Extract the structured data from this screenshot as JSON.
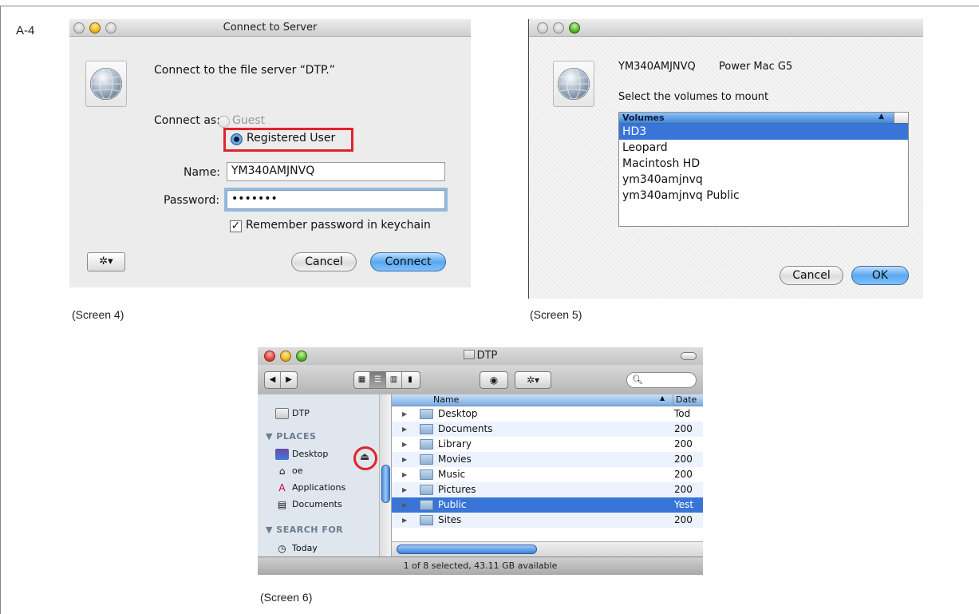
{
  "page_label": "A-4",
  "captions": {
    "screen4": "(Screen 4)",
    "screen5": "(Screen 5)",
    "screen6": "(Screen 6)"
  },
  "screen4": {
    "title": "Connect to Server",
    "message": "Connect to the file server “DTP.”",
    "connect_as_label": "Connect as:",
    "guest_label": "Guest",
    "registered_label": "Registered User",
    "name_label": "Name:",
    "name_value": "YM340AMJNVQ",
    "password_label": "Password:",
    "password_value": "•••••••",
    "remember_label": "Remember password in keychain",
    "cancel_label": "Cancel",
    "connect_label": "Connect",
    "gear_icon": "gear-icon"
  },
  "screen5": {
    "server_id": "YM340AMJNVQ",
    "server_model": "Power Mac G5",
    "instruction": "Select the volumes to mount",
    "column_header": "Volumes",
    "volumes": [
      "HD3",
      "Leopard",
      "Macintosh HD",
      "ym340amjnvq",
      "ym340amjnvq Public"
    ],
    "selected_volume": "HD3",
    "cancel_label": "Cancel",
    "ok_label": "OK"
  },
  "screen6": {
    "title": "DTP",
    "sidebar": {
      "device": "DTP",
      "places_header": "▼ PLACES",
      "places": [
        "Desktop",
        "oe",
        "Applications",
        "Documents"
      ],
      "search_header": "▼ SEARCH FOR",
      "search_items": [
        "Today"
      ]
    },
    "columns": {
      "name": "Name",
      "date": "Date"
    },
    "rows": [
      {
        "name": "Desktop",
        "date": "Tod"
      },
      {
        "name": "Documents",
        "date": "200"
      },
      {
        "name": "Library",
        "date": "200"
      },
      {
        "name": "Movies",
        "date": "200"
      },
      {
        "name": "Music",
        "date": "200"
      },
      {
        "name": "Pictures",
        "date": "200"
      },
      {
        "name": "Public",
        "date": "Yest",
        "selected": true
      },
      {
        "name": "Sites",
        "date": "200"
      }
    ],
    "status": "1 of 8 selected, 43.11 GB available",
    "search_placeholder": ""
  },
  "colors": {
    "highlight_red": "#e0232a",
    "selection_blue": "#3875d7"
  }
}
